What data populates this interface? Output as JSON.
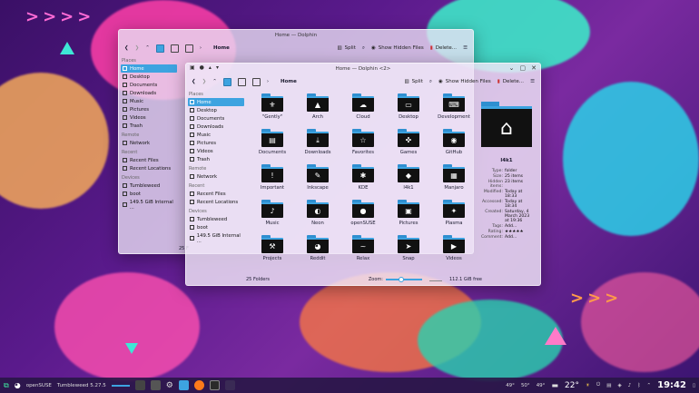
{
  "back_window": {
    "title": "Home — Dolphin",
    "toolbar": {
      "crumb": "Home",
      "split": "Split",
      "hidden": "Show Hidden Files",
      "delete": "Delete..."
    },
    "sidebar": {
      "places_head": "Places",
      "places": [
        "Home",
        "Desktop",
        "Documents",
        "Downloads",
        "Music",
        "Pictures",
        "Videos",
        "Trash"
      ],
      "remote_head": "Remote",
      "remote": [
        "Network"
      ],
      "recent_head": "Recent",
      "recent": [
        "Recent Files",
        "Recent Locations"
      ],
      "devices_head": "Devices",
      "devices": [
        "Tumbleweed",
        "boot",
        "149.5 GiB Internal ..."
      ]
    },
    "status_fragment": "25 F"
  },
  "front_window": {
    "title": "Home — Dolphin <2>",
    "toolbar": {
      "crumb": "Home",
      "split": "Split",
      "hidden": "Show Hidden Files",
      "delete": "Delete..."
    },
    "sidebar": {
      "places_head": "Places",
      "places": [
        "Home",
        "Desktop",
        "Documents",
        "Downloads",
        "Music",
        "Pictures",
        "Videos",
        "Trash"
      ],
      "remote_head": "Remote",
      "remote": [
        "Network"
      ],
      "recent_head": "Recent",
      "recent": [
        "Recent Files",
        "Recent Locations"
      ],
      "devices_head": "Devices",
      "devices": [
        "Tumbleweed",
        "boot",
        "149.5 GiB Internal ..."
      ]
    },
    "files": [
      {
        "name": "\"Gently\"",
        "icon": "⚜"
      },
      {
        "name": "Arch",
        "icon": "▲"
      },
      {
        "name": "Cloud",
        "icon": "☁"
      },
      {
        "name": "Desktop",
        "icon": "▭"
      },
      {
        "name": "Development",
        "icon": "⌨"
      },
      {
        "name": "Documents",
        "icon": "▤"
      },
      {
        "name": "Downloads",
        "icon": "⤓"
      },
      {
        "name": "Favorites",
        "icon": "☆"
      },
      {
        "name": "Games",
        "icon": "✜"
      },
      {
        "name": "GitHub",
        "icon": "◉"
      },
      {
        "name": "Important",
        "icon": "!"
      },
      {
        "name": "Inkscape",
        "icon": "✎"
      },
      {
        "name": "KDE",
        "icon": "✱"
      },
      {
        "name": "l4k1",
        "icon": "◆"
      },
      {
        "name": "Manjaro",
        "icon": "▦"
      },
      {
        "name": "Music",
        "icon": "♪"
      },
      {
        "name": "Neon",
        "icon": "◐"
      },
      {
        "name": "openSUSE",
        "icon": "●"
      },
      {
        "name": "Pictures",
        "icon": "▣"
      },
      {
        "name": "Plasma",
        "icon": "✦"
      },
      {
        "name": "Projects",
        "icon": "⚒"
      },
      {
        "name": "Reddit",
        "icon": "◕"
      },
      {
        "name": "Relax",
        "icon": "~"
      },
      {
        "name": "Snap",
        "icon": "➤"
      },
      {
        "name": "Videos",
        "icon": "▶"
      }
    ],
    "info": {
      "name": "l4k1",
      "rows": [
        {
          "k": "Type:",
          "v": "folder"
        },
        {
          "k": "Size:",
          "v": "25 items"
        },
        {
          "k": "Hidden items:",
          "v": "23 items"
        },
        {
          "k": "Modified:",
          "v": "Today at 18:33"
        },
        {
          "k": "Accessed:",
          "v": "Today at 18:34"
        },
        {
          "k": "Created:",
          "v": "Saturday, 4 March 2023 at 19:36"
        },
        {
          "k": "Tags:",
          "v": "Add..."
        },
        {
          "k": "Rating:",
          "v": "★★★★★"
        },
        {
          "k": "Comment:",
          "v": "Add..."
        }
      ]
    },
    "status": {
      "count": "25 Folders",
      "zoom": "Zoom:",
      "free": "112.1 GiB free",
      "zoom_level": 0.35
    }
  },
  "taskbar": {
    "distro": "openSUSE",
    "release": "Tumbleweed 5.27.5",
    "temps": [
      "49°",
      "50°",
      "49°"
    ],
    "weather": "22°",
    "clock": "19:42"
  },
  "colors": {
    "accent": "#3da3e0",
    "folder_tab": "#2f8fd0"
  }
}
